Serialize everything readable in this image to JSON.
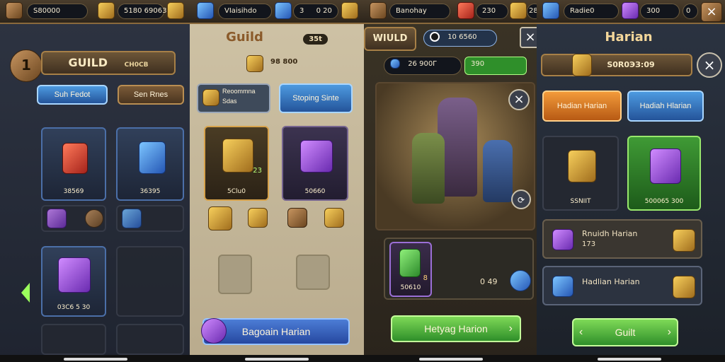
{
  "colors": {
    "gold": "#f7cf5c",
    "blue": "#2557b5",
    "green": "#2f8f2a",
    "orange": "#f29a3a"
  },
  "panel1": {
    "topbar": {
      "currency1_value": "Ѕ80000",
      "currency2_value": "5180 69063",
      "currency2_icon": "bronze-chest-icon"
    },
    "level": "1",
    "guild_title": "GUILD",
    "guild_subtitle": "CH0CB",
    "tab_active": "Suh Fedot",
    "tab_inactive": "Sen Rnes",
    "cards": [
      {
        "label": "38569",
        "icon": "demon-armor-icon"
      },
      {
        "label": "36395",
        "icon": "frost-knight-icon"
      },
      {
        "label": "03C6 5 30",
        "icon": "purple-crystal-icon"
      }
    ]
  },
  "panel2": {
    "topbar": {
      "title": "VIaisihdo",
      "value1": "3",
      "value2": "0 20"
    },
    "header_title": "Guild",
    "header_value": "35t",
    "gold_value": "98 800",
    "reward_label_1": "Reoommna",
    "reward_label_2": "Sdas",
    "button_stoping": "Stoping Sinte",
    "cards": [
      {
        "label": "5Clu0",
        "value": "23",
        "icon": "golden-shield-icon"
      },
      {
        "label": "50660",
        "icon": "dark-sword-icon"
      }
    ],
    "bottom_button": "Bagoain Harian"
  },
  "panel3": {
    "topbar": {
      "title": "Banohay",
      "value1": "230",
      "value2": "28"
    },
    "header_title": "WIULD",
    "header_value": "10 6560",
    "resource_value": "26 900Г",
    "green_value": "390",
    "item_label": "50610",
    "item_value": "8",
    "count_value": "0 49",
    "bottom_button": "Hetyag Harion"
  },
  "panel4": {
    "topbar": {
      "title": "Radie0",
      "value1": "300",
      "value2": "0"
    },
    "header_title": "Harian",
    "header_value": "S0R0ЭЗ:09",
    "tab_active": "Hadian Harian",
    "tab_inactive": "Hadiah Hlarian",
    "cards": [
      {
        "label": "SSNIIT",
        "icon": "golden-ticket-icon"
      },
      {
        "label": "500065 300",
        "icon": "purple-box-icon"
      }
    ],
    "rows": [
      {
        "title": "Rnuidh Harian",
        "value": "173",
        "icon": "purple-cube-icon"
      },
      {
        "title": "Hadlian Harian",
        "value": "",
        "icon": "blue-gem-icon"
      }
    ],
    "bottom_button": "Guilt"
  }
}
